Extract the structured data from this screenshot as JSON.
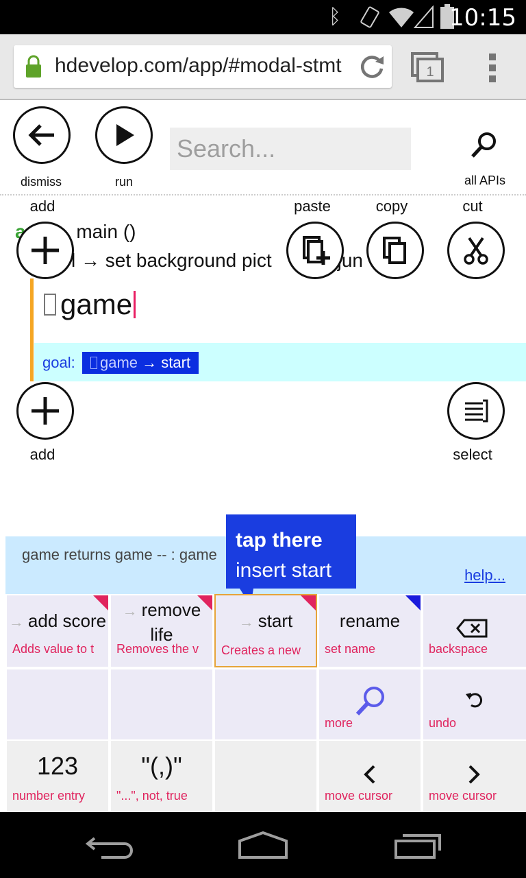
{
  "status_bar": {
    "time": "10:15"
  },
  "browser": {
    "url": "hdevelop.com/app/#modal-stmt",
    "tab_count": "1"
  },
  "toolbar": {
    "dismiss_label": "dismiss",
    "run_label": "run",
    "search_placeholder": "Search...",
    "all_apis_label": "all APIs"
  },
  "edit_actions": {
    "add_label": "add",
    "paste_label": "paste",
    "copy_label": "copy",
    "cut_label": "cut",
    "add_bottom_label": "add",
    "select_label": "select"
  },
  "code": {
    "line1_prefix": "a",
    "line1_text": "main ()",
    "line2_text": "l → set background pict",
    "line2_suffix": "jun",
    "current_token": "game",
    "goal_label": "goal:",
    "goal_chip_token": "game",
    "goal_chip_rest": " → start"
  },
  "tooltip": {
    "line1": "tap there",
    "line2": "insert start"
  },
  "info": {
    "text": "game returns   game -- : game",
    "help": "help..."
  },
  "keypad": {
    "keys": [
      {
        "label": "add score",
        "sub": "Adds value to t"
      },
      {
        "label": "remove life",
        "sub": "Removes the v"
      },
      {
        "label": "start",
        "sub": "Creates a new"
      },
      {
        "label": "rename",
        "sub": "set name"
      },
      {
        "label": "",
        "sub": "backspace"
      },
      {
        "label": "",
        "sub": "more"
      },
      {
        "label": "",
        "sub": "undo"
      },
      {
        "label": "123",
        "sub": "number entry"
      },
      {
        "label": "\"(,)\"",
        "sub": "\"...\", not, true"
      },
      {
        "label": "",
        "sub": "move cursor"
      },
      {
        "label": "",
        "sub": "move cursor"
      }
    ]
  }
}
